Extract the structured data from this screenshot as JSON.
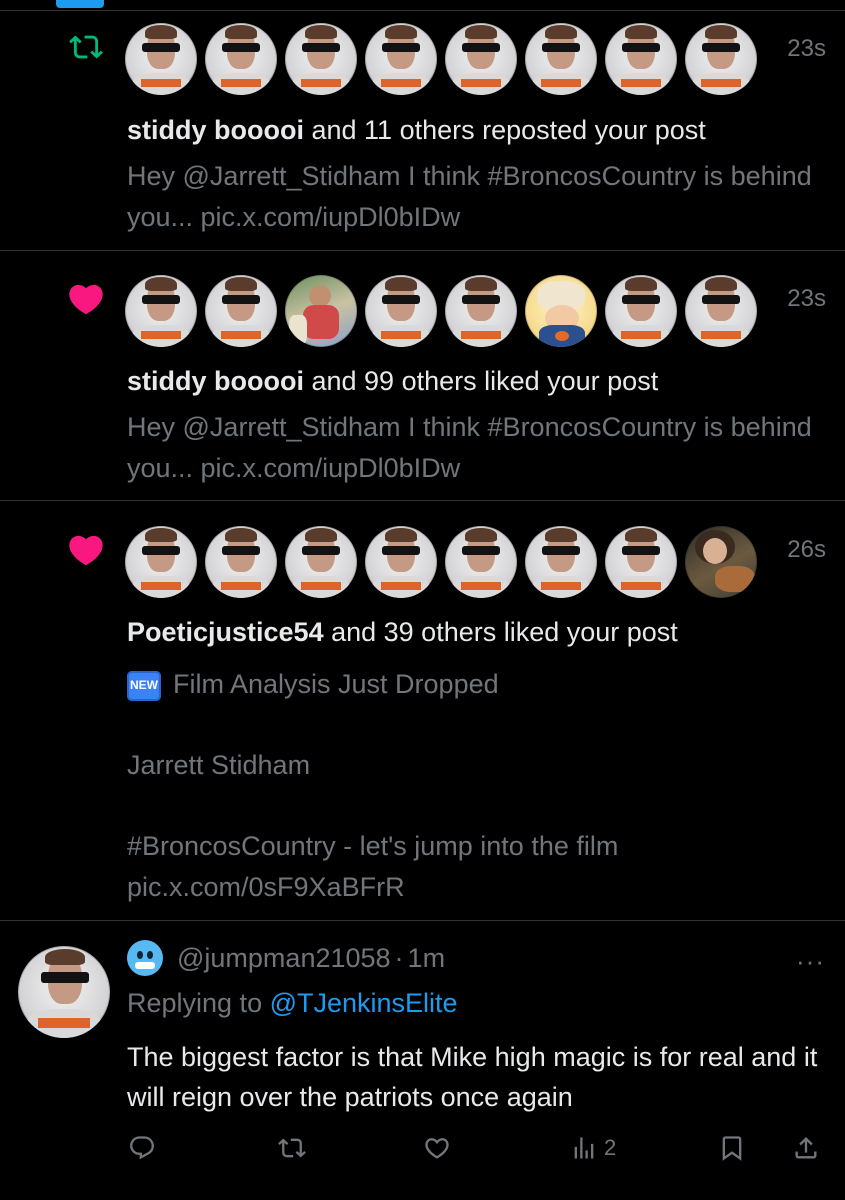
{
  "colors": {
    "background": "#000000",
    "text_primary": "#e7e9ea",
    "text_secondary": "#71767b",
    "repost_green": "#00ba7c",
    "like_pink": "#f91880",
    "link_blue": "#1d9bf0",
    "divider": "#2f3336"
  },
  "notifications": [
    {
      "icon": "repost-icon",
      "avatars": [
        "person",
        "person",
        "person",
        "person",
        "person",
        "person",
        "person",
        "person"
      ],
      "timestamp": "23s",
      "actor": "stiddy booooi",
      "summary_rest": " and 11 others reposted your post",
      "post_text": "Hey @Jarrett_Stidham I think #BroncosCountry is behind you... pic.x.com/iupDl0bIDw"
    },
    {
      "icon": "heart-icon",
      "avatars": [
        "person",
        "person",
        "photo",
        "person",
        "person",
        "cartoon",
        "person",
        "person"
      ],
      "timestamp": "23s",
      "actor": "stiddy booooi",
      "summary_rest": " and 99 others liked your post",
      "post_text": "Hey @Jarrett_Stidham I think #BroncosCountry is behind you... pic.x.com/iupDl0bIDw"
    },
    {
      "icon": "heart-icon",
      "avatars": [
        "person",
        "person",
        "person",
        "person",
        "person",
        "person",
        "person",
        "guitar"
      ],
      "timestamp": "26s",
      "actor": "Poeticjustice54",
      "summary_rest": " and 39 others liked your post",
      "new_badge": "NEW",
      "post_line1": "Film Analysis Just Dropped",
      "post_line2": "Jarrett Stidham",
      "post_line3": "#BroncosCountry - let's jump into the film",
      "post_line4": "pic.x.com/0sF9XaBFrR"
    }
  ],
  "reply": {
    "emoji": "cold-face-emoji",
    "handle": "@jumpman21058",
    "separator": "·",
    "time": "1m",
    "replying_prefix": "Replying to ",
    "replying_handle": "@TJenkinsElite",
    "text": "The biggest factor is that Mike high magic is for real and it will reign over the patriots once again",
    "more": "···",
    "actions": {
      "reply_icon": "reply-icon",
      "repost_icon": "repost-icon",
      "like_icon": "heart-outline-icon",
      "views_icon": "views-icon",
      "views_count": "2",
      "bookmark_icon": "bookmark-icon",
      "share_icon": "share-icon"
    }
  }
}
